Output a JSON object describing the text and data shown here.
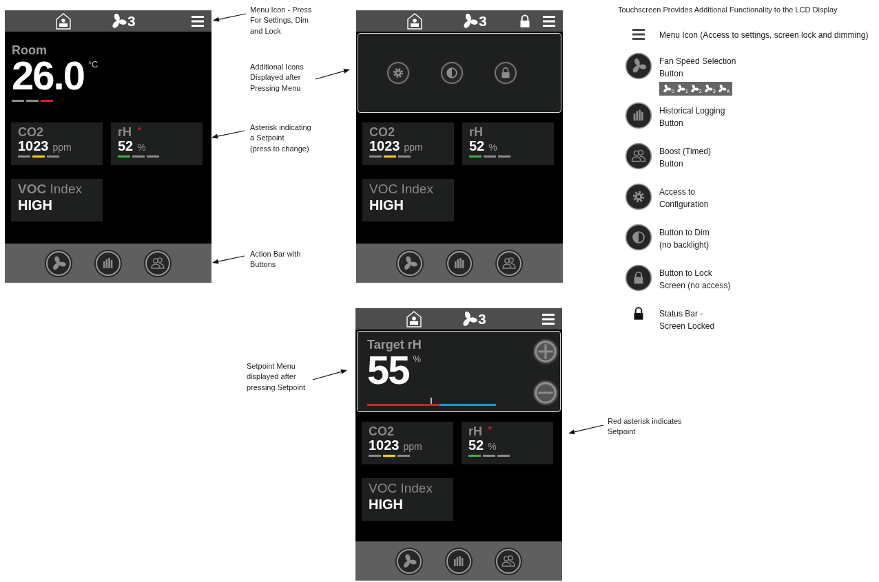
{
  "screens": [
    {
      "status_bar": {
        "fan_speed": "3",
        "locked": false
      },
      "panel": {
        "kind": "reading",
        "label": "Room",
        "value": "26.0",
        "unit": "°C",
        "segments": [
          {
            "color": "#8c8c8c"
          },
          {
            "color": "#8c8c8c"
          },
          {
            "color": "#e31e24"
          }
        ]
      },
      "tiles": [
        {
          "kind": "meter",
          "label": "CO2",
          "value": "1023",
          "unit": "ppm",
          "segments": [
            {
              "color": "#8c8c8c"
            },
            {
              "color": "#ffd200"
            },
            {
              "color": "#8c8c8c"
            }
          ]
        },
        {
          "kind": "meter",
          "label": "rH",
          "asterisk": "*",
          "value": "52",
          "unit": "%",
          "segments": [
            {
              "color": "#3cb44a"
            },
            {
              "color": "#8c8c8c"
            },
            {
              "color": "#8c8c8c"
            }
          ]
        },
        {
          "kind": "text",
          "label": "**VOC** Index",
          "value": "HIGH"
        }
      ],
      "action_buttons": [
        {
          "kind": "fan"
        },
        {
          "kind": "history"
        },
        {
          "kind": "boost"
        }
      ]
    },
    {
      "status_bar": {
        "fan_speed": "3",
        "locked": true
      },
      "panel": {
        "kind": "menu",
        "buttons": [
          {
            "kind": "settings"
          },
          {
            "kind": "dim"
          },
          {
            "kind": "lock"
          }
        ]
      },
      "tiles": [
        {
          "kind": "meter",
          "label": "CO2",
          "value": "1023",
          "unit": "ppm",
          "segments": [
            {
              "color": "#8c8c8c"
            },
            {
              "color": "#ffd200"
            },
            {
              "color": "#8c8c8c"
            }
          ]
        },
        {
          "kind": "meter",
          "label": "rH",
          "value": "52",
          "unit": "%",
          "segments": [
            {
              "color": "#3cb44a"
            },
            {
              "color": "#8c8c8c"
            },
            {
              "color": "#8c8c8c"
            }
          ]
        },
        {
          "kind": "text",
          "label": "VOC Index",
          "value": "HIGH"
        }
      ],
      "action_buttons": [
        {
          "kind": "fan"
        },
        {
          "kind": "history"
        },
        {
          "kind": "boost"
        }
      ]
    },
    {
      "status_bar": {
        "fan_speed": "3",
        "locked": false
      },
      "panel": {
        "kind": "setpoint",
        "label": "Target rH",
        "value": "55",
        "unit": "%",
        "level": 0.49,
        "track": [
          {
            "color": "#d71f26",
            "level": 0.56
          },
          {
            "color": "#00a0e3",
            "level": 0.44
          }
        ],
        "buttons": [
          {
            "kind": "plus"
          },
          {
            "kind": "minus"
          }
        ]
      },
      "tiles": [
        {
          "kind": "meter",
          "label": "CO2",
          "value": "1023",
          "unit": "ppm",
          "segments": [
            {
              "color": "#8c8c8c"
            },
            {
              "color": "#ffd200"
            },
            {
              "color": "#8c8c8c"
            }
          ]
        },
        {
          "kind": "meter",
          "label": "rH",
          "asterisk": "*",
          "value": "52",
          "unit": "%",
          "segments": [
            {
              "color": "#3cb44a"
            },
            {
              "color": "#8c8c8c"
            },
            {
              "color": "#8c8c8c"
            }
          ]
        },
        {
          "kind": "text",
          "label": "VOC Index",
          "value": "HIGH"
        }
      ],
      "action_buttons": [
        {
          "kind": "fan"
        },
        {
          "kind": "history"
        },
        {
          "kind": "boost"
        }
      ]
    }
  ],
  "annotations": [
    {
      "text": "Menu Icon - Press\nFor Settings, Dim\nand Lock"
    },
    {
      "text": "Additional Icons\nDisplayed after\nPressing Menu"
    },
    {
      "text": "Asterisk indicating\na Setpoint\n(press to change)"
    },
    {
      "text": "Action Bar with\nButtons"
    },
    {
      "text": "Setpoint Menu\ndisplayed after\npressing Setpoint"
    },
    {
      "text": "Red asterisk indicates\nSetpoint"
    }
  ],
  "legend": {
    "title": "Touchscreen Provides Additional Functionality  to the LCD Display",
    "items": [
      {
        "kind": "menu",
        "text": "Menu Icon (Access to settings, screen lock and dimming)"
      },
      {
        "kind": "fan",
        "text": "Fan Speed Selection\nButton",
        "speed_labels": [
          "0",
          "1",
          "2",
          "3",
          "A"
        ]
      },
      {
        "kind": "history",
        "text": "Historical Logging\nButton"
      },
      {
        "kind": "boost",
        "text": "Boost (Timed)\nButton"
      },
      {
        "kind": "settings",
        "text": "Access to\nConfiguration"
      },
      {
        "kind": "dim",
        "text": "Button to Dim\n(no backlight)"
      },
      {
        "kind": "lock",
        "text": "Button to Lock\nScreen (no access)"
      },
      {
        "kind": "status_lock",
        "text": "Status Bar -\nScreen Locked"
      }
    ]
  }
}
